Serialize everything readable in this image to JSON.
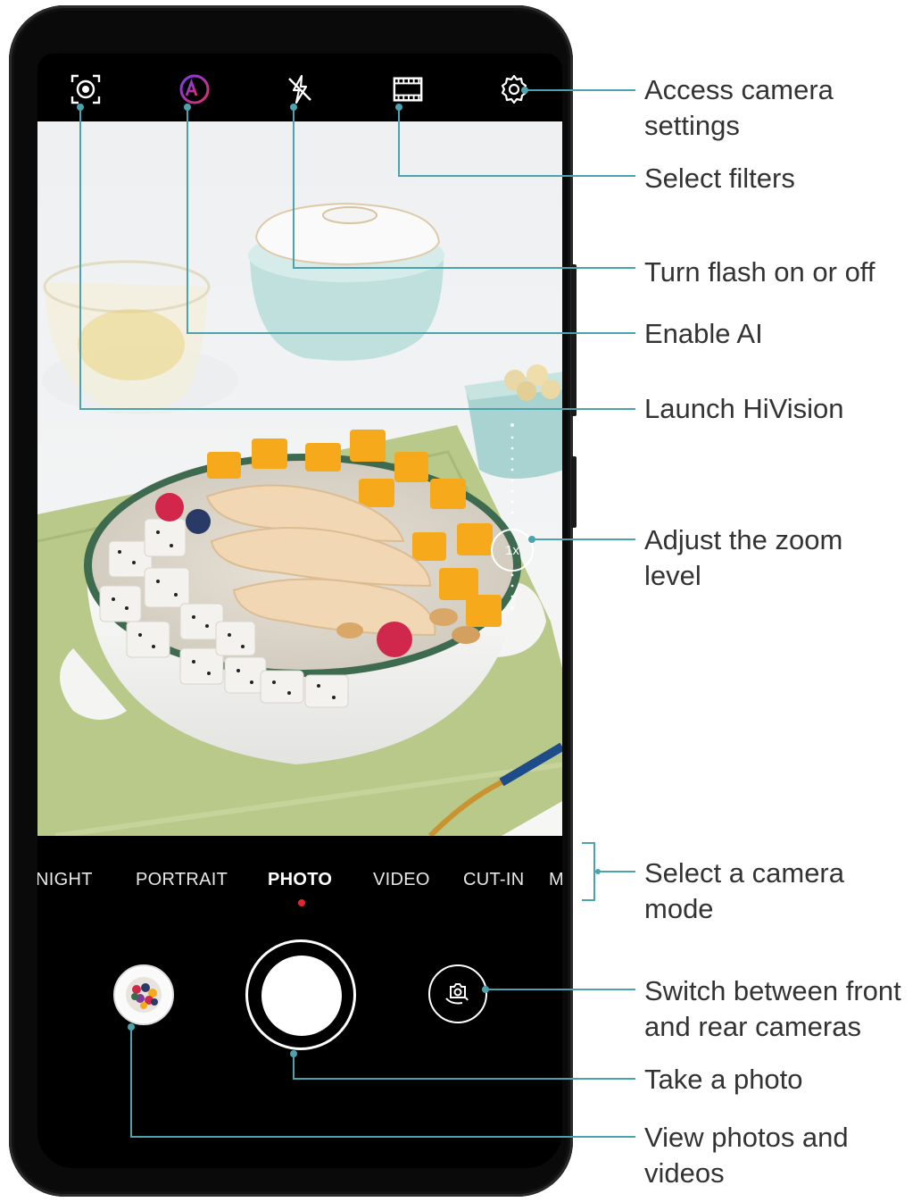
{
  "camera_modes": {
    "items": [
      "NIGHT",
      "PORTRAIT",
      "PHOTO",
      "VIDEO",
      "CUT-IN",
      "M"
    ],
    "active": "PHOTO"
  },
  "zoom": {
    "label": "1x"
  },
  "top_icons": [
    "hivision-icon",
    "ai-icon",
    "flash-off-icon",
    "filter-icon",
    "settings-icon"
  ],
  "callouts": {
    "settings": "Access camera settings",
    "filters": "Select filters",
    "flash": "Turn flash on or off",
    "ai": "Enable AI",
    "hivision": "Launch HiVision",
    "zoom": "Adjust the zoom level",
    "mode": "Select a camera mode",
    "switch": "Switch between front and rear cameras",
    "shutter": "Take a photo",
    "gallery": "View photos and videos"
  },
  "colors": {
    "callout_line": "#4da3ad",
    "mode_indicator": "#e3262b",
    "ai_gradient_start": "#7b3fe4",
    "ai_gradient_end": "#e02c6d"
  }
}
